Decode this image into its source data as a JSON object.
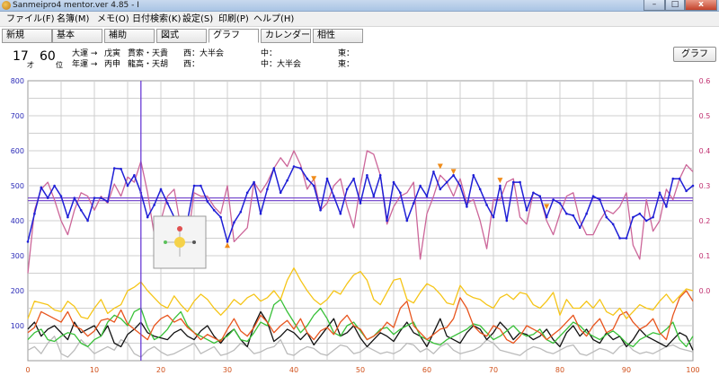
{
  "window": {
    "title": "Sanmeipro4 mentor.ver 4.85 - I",
    "min_label": "–",
    "max_label": "□",
    "close_label": "x"
  },
  "menu": [
    "ファイル(F)",
    "名簿(M)",
    "メモ(O)",
    "日付検索(K)",
    "設定(S)",
    "印刷(P)",
    "ヘルプ(H)"
  ],
  "tabs": [
    "新規",
    "基本",
    "補助",
    "図式",
    "グラフ",
    "カレンダー",
    "相性"
  ],
  "active_tab": "グラフ",
  "info": {
    "age": "17",
    "age_unit": "才",
    "rank": "60",
    "rank_unit": "位",
    "daiun_label": "大運 →",
    "daiun_kanshi": "戊寅",
    "daiun_stars": "貫索・天貴",
    "nenun_label": "年運 →",
    "nenun_kanshi": "丙申",
    "nenun_stars": "龍高・天胡",
    "west1": "西：大半会",
    "west2": "西：",
    "center1": "中：",
    "center2": "中：大半会",
    "east1": "東：",
    "east2": "東："
  },
  "graph_button": "グラフ",
  "chart_data": {
    "type": "line",
    "x_ticks": [
      0,
      10,
      20,
      30,
      40,
      50,
      60,
      70,
      80,
      90,
      100
    ],
    "xlim": [
      0,
      100
    ],
    "ylim_left": [
      0,
      800
    ],
    "y_ticks_left": [
      100,
      200,
      300,
      400,
      500,
      600,
      700,
      800
    ],
    "ylim_right": [
      -0.1,
      0.6
    ],
    "y_ticks_right": [
      "0.6",
      "0.5",
      "0.4",
      "0.3",
      "0.2",
      "0.1",
      "0.0"
    ],
    "grid": true,
    "current_x": 17,
    "reference_line": 460,
    "series": [
      {
        "color": "#1f1fd6",
        "axis": "left",
        "values": [
          340,
          420,
          495,
          465,
          500,
          470,
          410,
          465,
          430,
          400,
          465,
          465,
          455,
          550,
          548,
          500,
          530,
          480,
          410,
          445,
          490,
          450,
          410,
          400,
          400,
          500,
          500,
          455,
          430,
          410,
          340,
          395,
          425,
          480,
          510,
          420,
          490,
          550,
          480,
          515,
          555,
          550,
          520,
          500,
          430,
          520,
          470,
          420,
          490,
          520,
          450,
          530,
          470,
          530,
          400,
          510,
          480,
          400,
          450,
          500,
          470,
          540,
          490,
          510,
          530,
          500,
          440,
          530,
          490,
          445,
          410,
          500,
          400,
          510,
          510,
          430,
          480,
          470,
          410,
          460,
          450,
          420,
          415,
          380,
          420,
          470,
          460,
          410,
          390,
          350,
          350,
          410,
          420,
          400,
          410,
          480,
          440,
          520,
          520,
          485,
          500
        ]
      },
      {
        "color": "#cc6699",
        "axis": "left",
        "values": [
          250,
          430,
          490,
          510,
          460,
          400,
          360,
          430,
          480,
          470,
          430,
          470,
          450,
          505,
          470,
          525,
          510,
          570,
          480,
          360,
          400,
          470,
          490,
          380,
          340,
          480,
          470,
          470,
          440,
          420,
          500,
          340,
          360,
          380,
          510,
          480,
          510,
          550,
          580,
          555,
          600,
          560,
          490,
          520,
          430,
          450,
          500,
          520,
          440,
          380,
          500,
          600,
          590,
          530,
          390,
          440,
          470,
          480,
          510,
          290,
          420,
          470,
          530,
          510,
          470,
          520,
          450,
          460,
          400,
          320,
          460,
          460,
          510,
          520,
          410,
          390,
          480,
          470,
          400,
          360,
          420,
          470,
          480,
          400,
          360,
          360,
          400,
          430,
          420,
          440,
          480,
          330,
          290,
          460,
          370,
          400,
          490,
          460,
          520,
          560,
          540
        ]
      },
      {
        "color": "#f5c518",
        "axis": "left",
        "values": [
          120,
          170,
          165,
          160,
          145,
          140,
          170,
          155,
          125,
          120,
          150,
          175,
          135,
          150,
          160,
          200,
          210,
          225,
          200,
          180,
          160,
          150,
          185,
          160,
          140,
          170,
          190,
          175,
          150,
          130,
          150,
          175,
          160,
          180,
          190,
          170,
          180,
          200,
          175,
          230,
          265,
          230,
          200,
          175,
          160,
          175,
          200,
          190,
          220,
          245,
          255,
          230,
          175,
          160,
          195,
          230,
          235,
          175,
          165,
          195,
          220,
          210,
          190,
          165,
          160,
          215,
          190,
          180,
          175,
          160,
          150,
          180,
          190,
          175,
          195,
          190,
          160,
          150,
          170,
          195,
          130,
          175,
          150,
          150,
          170,
          150,
          175,
          140,
          130,
          150,
          120,
          140,
          160,
          150,
          145,
          170,
          190,
          165,
          185,
          205,
          200
        ]
      },
      {
        "color": "#e8551e",
        "axis": "left",
        "values": [
          80,
          95,
          140,
          130,
          120,
          110,
          140,
          100,
          90,
          70,
          85,
          115,
          120,
          110,
          145,
          105,
          90,
          75,
          60,
          100,
          120,
          130,
          110,
          120,
          95,
          80,
          60,
          75,
          65,
          55,
          90,
          120,
          85,
          70,
          95,
          130,
          110,
          80,
          100,
          115,
          90,
          120,
          80,
          60,
          85,
          95,
          75,
          110,
          130,
          100,
          90,
          60,
          70,
          85,
          110,
          95,
          150,
          170,
          100,
          80,
          60,
          75,
          90,
          95,
          120,
          180,
          150,
          100,
          80,
          70,
          100,
          90,
          60,
          50,
          70,
          100,
          90,
          80,
          60,
          75,
          90,
          110,
          130,
          90,
          70,
          100,
          120,
          80,
          90,
          130,
          140,
          110,
          90,
          100,
          120,
          80,
          60,
          130,
          180,
          200,
          170
        ]
      },
      {
        "color": "#38c038",
        "axis": "left",
        "values": [
          60,
          80,
          90,
          60,
          55,
          70,
          80,
          75,
          50,
          40,
          60,
          70,
          110,
          130,
          120,
          100,
          140,
          150,
          95,
          60,
          70,
          90,
          120,
          140,
          100,
          80,
          70,
          60,
          50,
          60,
          70,
          90,
          60,
          55,
          80,
          110,
          100,
          160,
          175,
          140,
          110,
          80,
          100,
          130,
          150,
          120,
          80,
          70,
          100,
          110,
          85,
          60,
          70,
          90,
          95,
          75,
          90,
          100,
          110,
          70,
          60,
          50,
          45,
          60,
          70,
          80,
          90,
          105,
          100,
          80,
          60,
          70,
          85,
          100,
          80,
          70,
          75,
          90,
          60,
          50,
          70,
          90,
          110,
          100,
          80,
          70,
          60,
          75,
          85,
          70,
          50,
          40,
          60,
          70,
          80,
          75,
          90,
          110,
          60,
          40,
          70
        ]
      },
      {
        "color": "#111111",
        "axis": "left",
        "values": [
          90,
          110,
          70,
          90,
          100,
          80,
          60,
          110,
          80,
          90,
          100,
          70,
          100,
          50,
          40,
          75,
          90,
          110,
          80,
          70,
          65,
          60,
          80,
          90,
          70,
          60,
          85,
          100,
          70,
          50,
          75,
          90,
          60,
          40,
          100,
          140,
          110,
          55,
          70,
          90,
          80,
          60,
          80,
          45,
          70,
          95,
          120,
          70,
          80,
          100,
          65,
          40,
          60,
          80,
          70,
          55,
          85,
          110,
          80,
          70,
          40,
          80,
          120,
          70,
          60,
          50,
          80,
          100,
          90,
          60,
          80,
          110,
          90,
          60,
          80,
          75,
          60,
          70,
          90,
          60,
          40,
          80,
          100,
          70,
          90,
          60,
          50,
          80,
          60,
          70,
          40,
          60,
          90,
          70,
          60,
          50,
          40,
          60,
          80,
          70,
          30
        ]
      },
      {
        "color": "#bbbbbb",
        "axis": "left",
        "values": [
          30,
          40,
          20,
          50,
          70,
          20,
          10,
          30,
          60,
          40,
          20,
          30,
          40,
          30,
          60,
          50,
          20,
          10,
          30,
          40,
          25,
          15,
          20,
          30,
          40,
          50,
          20,
          30,
          40,
          15,
          20,
          30,
          50,
          40,
          20,
          25,
          35,
          40,
          60,
          20,
          15,
          30,
          40,
          35,
          20,
          15,
          30,
          45,
          40,
          20,
          25,
          40,
          30,
          20,
          25,
          20,
          30,
          50,
          45,
          25,
          35,
          20,
          40,
          50,
          30,
          20,
          25,
          30,
          40,
          60,
          50,
          30,
          25,
          20,
          15,
          30,
          40,
          35,
          25,
          20,
          30,
          40,
          45,
          20,
          15,
          25,
          35,
          30,
          20,
          40,
          50,
          30,
          20,
          25,
          20,
          30,
          40,
          45,
          35,
          30,
          25
        ]
      }
    ],
    "markers": [
      {
        "x": 30,
        "y": 330,
        "shape": "up"
      },
      {
        "x": 43,
        "y": 520,
        "shape": "down"
      },
      {
        "x": 62,
        "y": 555,
        "shape": "down"
      },
      {
        "x": 64,
        "y": 540,
        "shape": "down"
      },
      {
        "x": 71,
        "y": 515,
        "shape": "down"
      },
      {
        "x": 78,
        "y": 440,
        "shape": "down"
      }
    ]
  }
}
